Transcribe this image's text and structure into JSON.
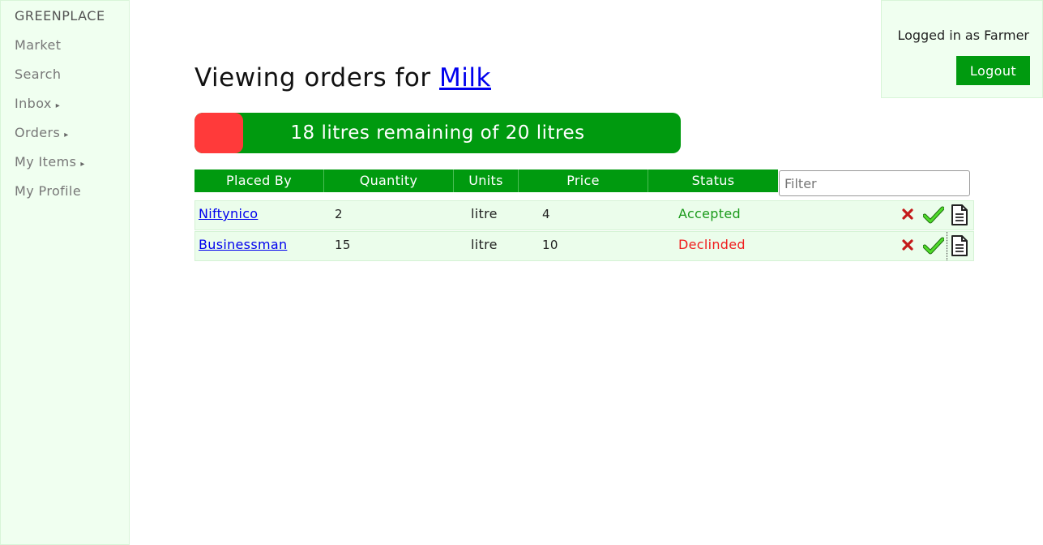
{
  "sidebar": {
    "brand": "GREENPLACE",
    "items": [
      {
        "label": "Market",
        "caret": ""
      },
      {
        "label": "Search",
        "caret": ""
      },
      {
        "label": "Inbox",
        "caret": "▸"
      },
      {
        "label": "Orders",
        "caret": "▸"
      },
      {
        "label": "My Items",
        "caret": "▸"
      },
      {
        "label": "My Profile",
        "caret": ""
      }
    ]
  },
  "header": {
    "logged_in_text": "Logged in as Farmer",
    "logout_label": "Logout"
  },
  "page": {
    "title_prefix": "Viewing orders for",
    "title_link": "Milk"
  },
  "progress": {
    "label": "18 litres remaining of 20 litres",
    "used_fraction": 0.1,
    "used_color": "#ff3a3a",
    "remaining_color": "#009a0f"
  },
  "table": {
    "headers": [
      "Placed By",
      "Quantity",
      "Units",
      "Price",
      "Status"
    ],
    "filter_placeholder": "Filter",
    "rows": [
      {
        "placed_by": "Niftynico",
        "quantity": "2",
        "units": "litre",
        "price": "4",
        "status": "Accepted",
        "status_color": "#1a9a1a"
      },
      {
        "placed_by": "Businessman",
        "quantity": "15",
        "units": "litre",
        "price": "10",
        "status": "Declinded",
        "status_color": "#f01d1d"
      }
    ],
    "row_actions": [
      "reject-icon",
      "accept-check-icon",
      "document-icon"
    ]
  },
  "colors": {
    "accent": "#009a0f",
    "sidebar_bg": "#f0fff0",
    "row_bg": "#ebfdeb"
  }
}
